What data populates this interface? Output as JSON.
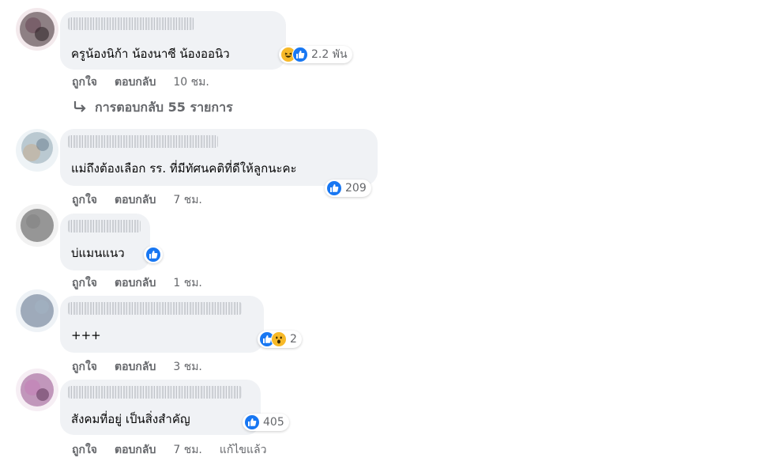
{
  "comments": [
    {
      "text": "ครูน้องนิก้า น้องนาซี น้องออนิว",
      "reaction_count": "2.2 พัน",
      "reactions": [
        "like-icon",
        "haha-icon"
      ],
      "like_label": "ถูกใจ",
      "reply_label": "ตอบกลับ",
      "time": "10 ชม."
    },
    {
      "text": "แม่ถึงต้องเลือก รร. ที่มีทัศนคติที่ดีให้ลูกนะคะ",
      "reaction_count": "209",
      "reactions": [
        "like-icon"
      ],
      "like_label": "ถูกใจ",
      "reply_label": "ตอบกลับ",
      "time": "7 ชม."
    },
    {
      "text": "บ่แมนแนว",
      "reaction_count": "",
      "reactions": [
        "like-icon"
      ],
      "like_label": "ถูกใจ",
      "reply_label": "ตอบกลับ",
      "time": "1 ชม."
    },
    {
      "text": "+++",
      "reaction_count": "2",
      "reactions": [
        "like-icon",
        "wow-icon"
      ],
      "like_label": "ถูกใจ",
      "reply_label": "ตอบกลับ",
      "time": "3 ชม."
    },
    {
      "text": "สังคมที่อยู่ เป็นสิ่งสำคัญ",
      "reaction_count": "405",
      "reactions": [
        "like-icon"
      ],
      "like_label": "ถูกใจ",
      "reply_label": "ตอบกลับ",
      "time": "7 ชม.",
      "edited": "แก้ไขแล้ว"
    }
  ],
  "replies_link": "การตอบกลับ 55 รายการ",
  "colors": {
    "bubble": "#f0f2f5",
    "like": "#1877f2",
    "secondary_text": "#65676b",
    "emoji": "#f7b928"
  }
}
